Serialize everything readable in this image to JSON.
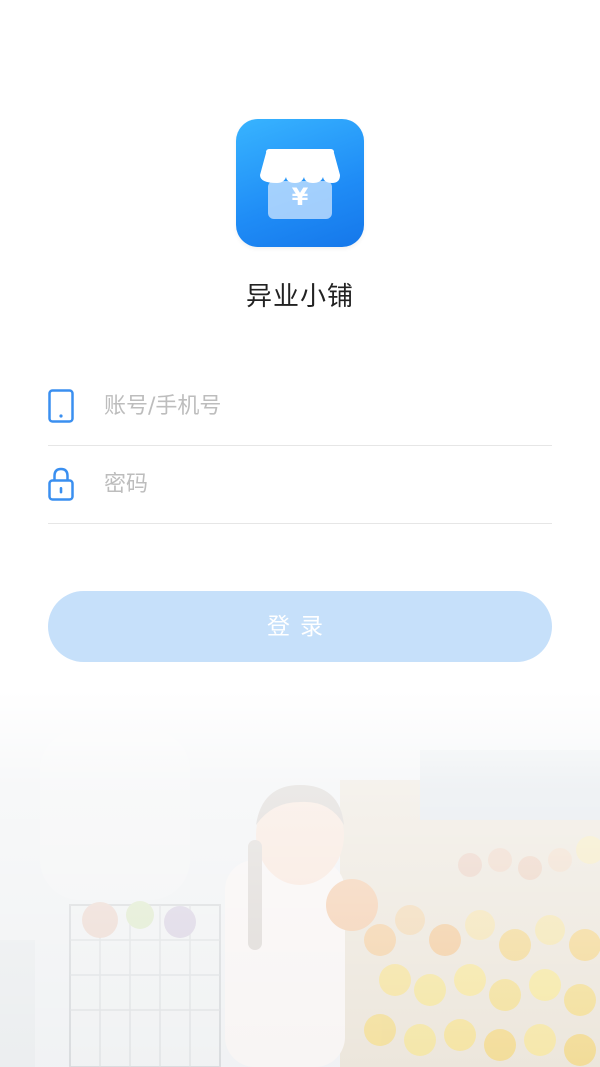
{
  "app": {
    "name": "异业小铺",
    "logo_symbol": "¥",
    "logo_icon": "shop-awning-icon",
    "brand_color": "#2196f3",
    "button_color": "#c6e0fa"
  },
  "form": {
    "account_placeholder": "账号/手机号",
    "account_icon": "phone-icon",
    "password_placeholder": "密码",
    "password_icon": "lock-icon",
    "login_label": "登录"
  },
  "background": {
    "image": "supermarket-girl-photo"
  }
}
